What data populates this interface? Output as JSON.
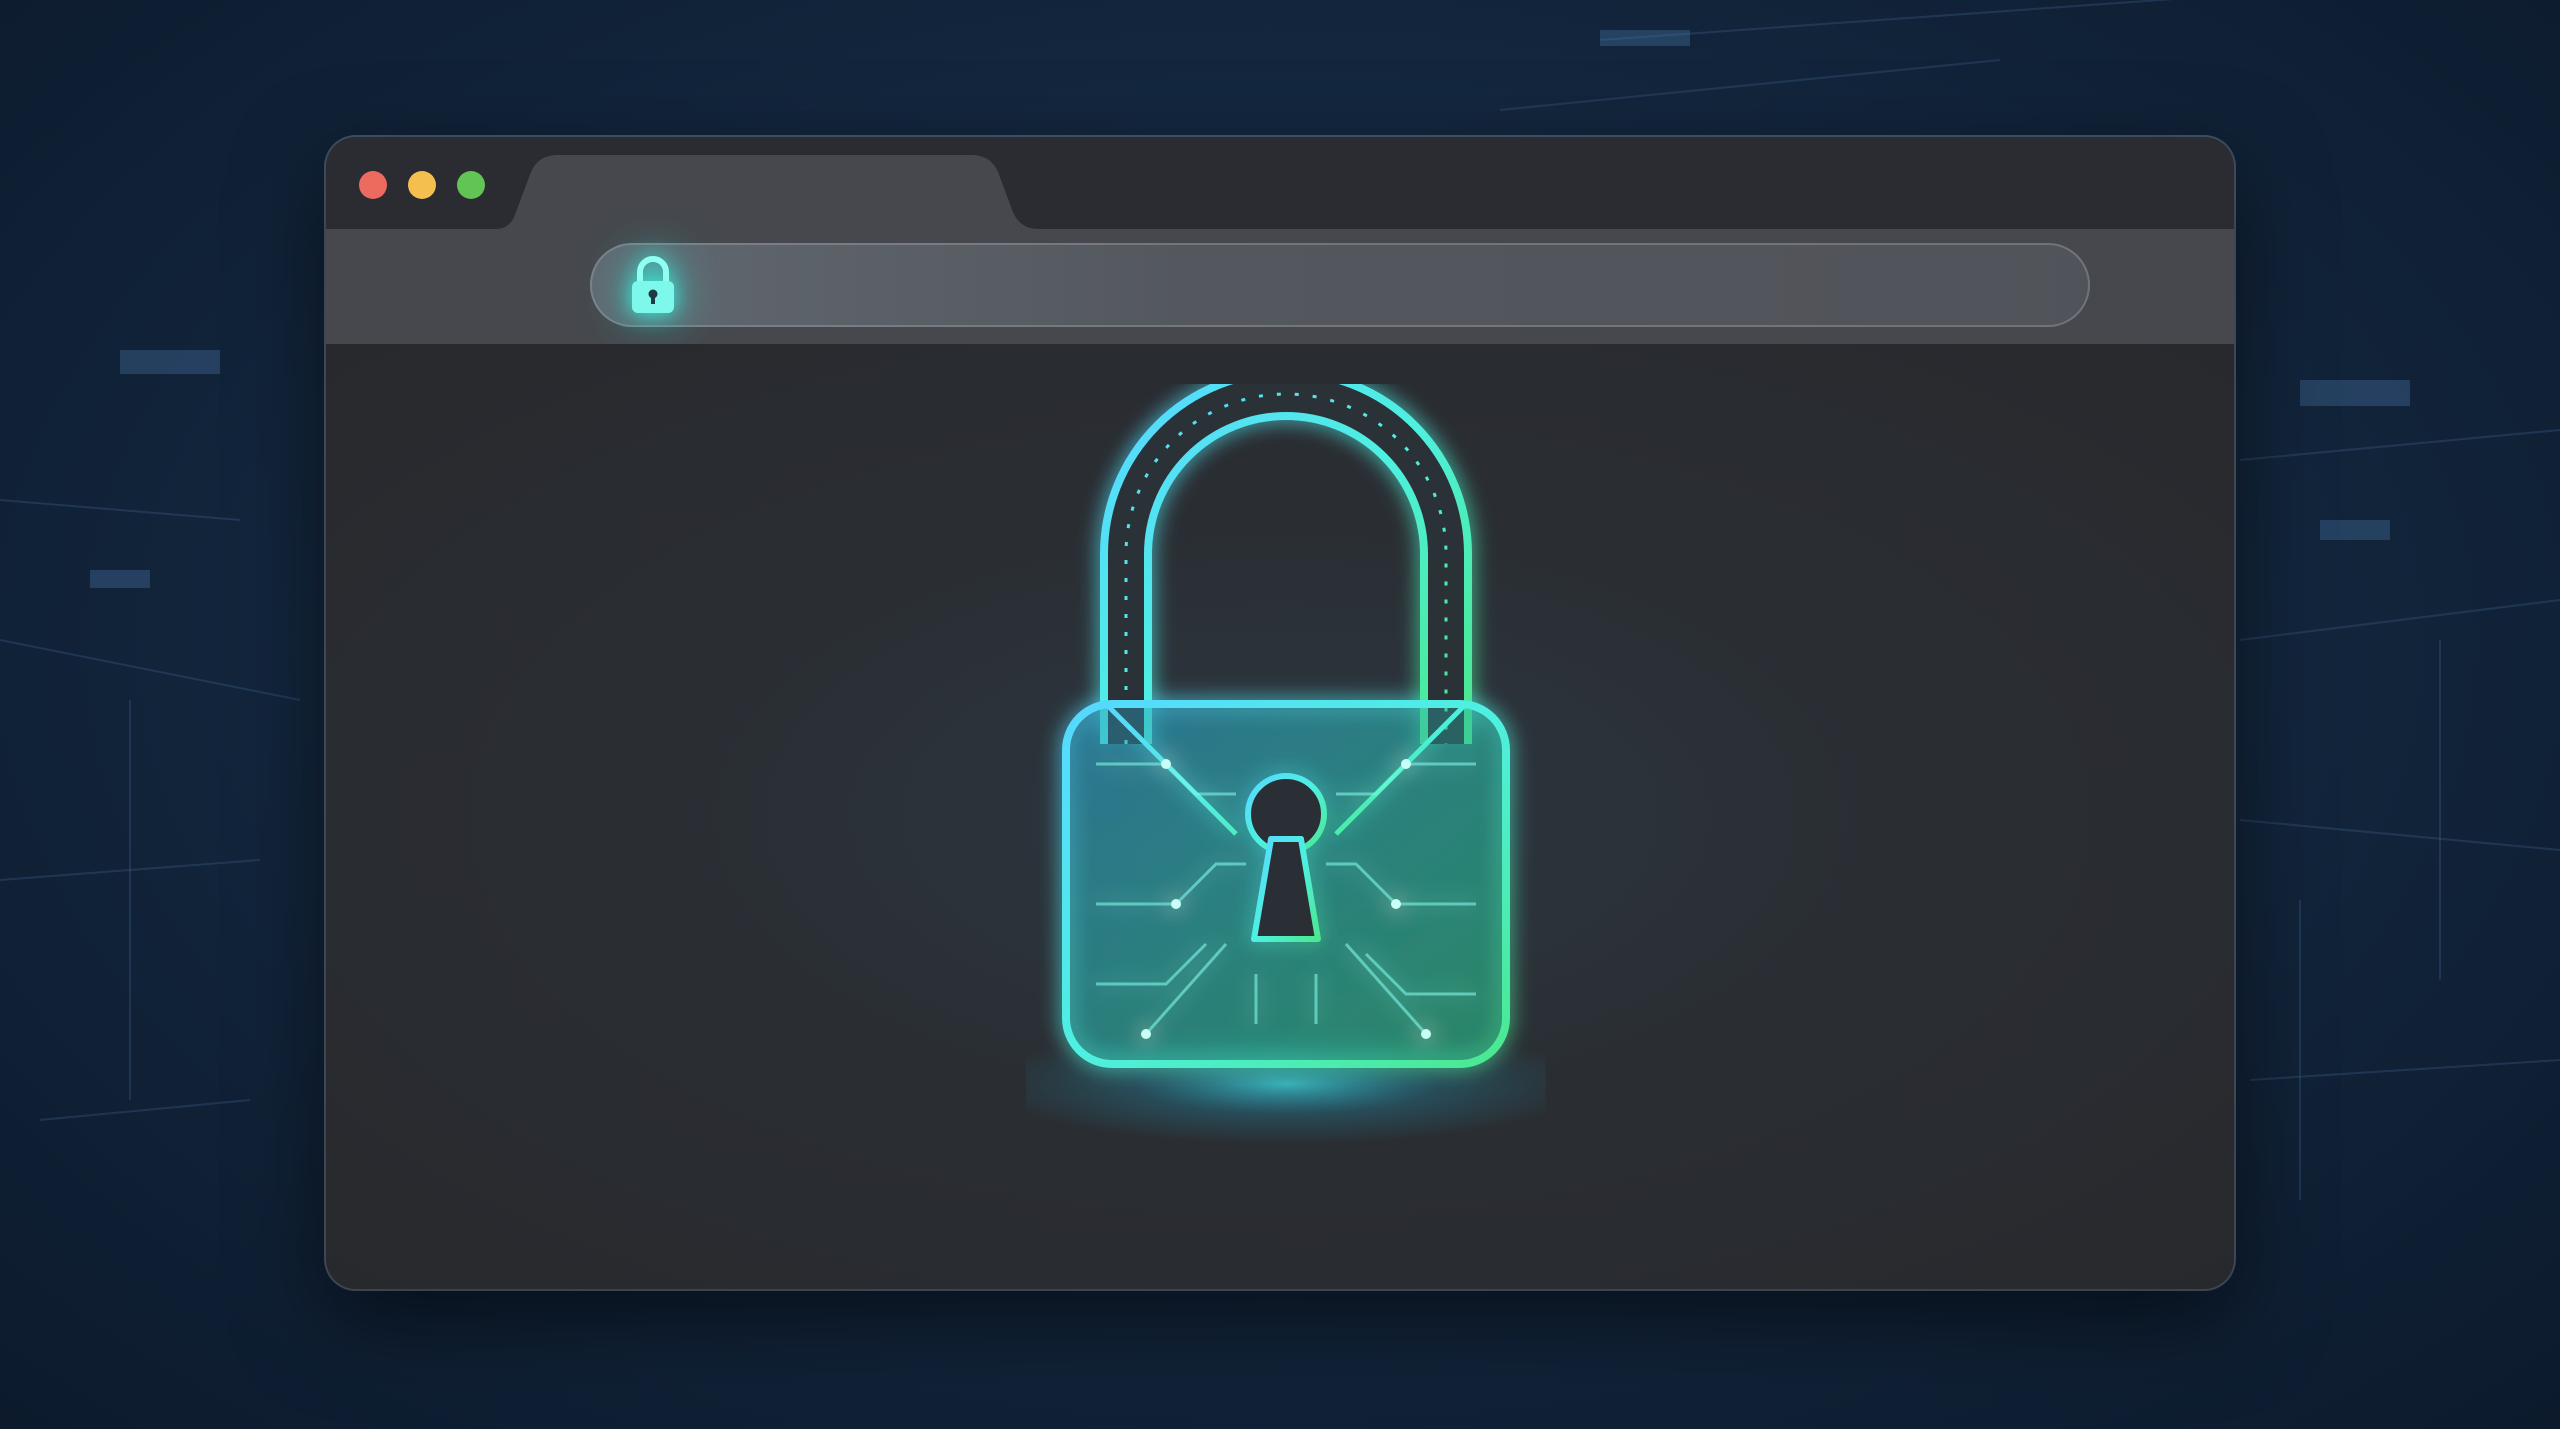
{
  "window": {
    "traffic_lights": [
      "close",
      "minimize",
      "maximize"
    ],
    "tab": {
      "title": ""
    }
  },
  "address_bar": {
    "icon": "lock-icon",
    "url": ""
  },
  "content": {
    "hero_icon": "padlock-circuit-icon"
  },
  "colors": {
    "background": "#142840",
    "window": "#2b2e34",
    "toolbar": "#46484d",
    "accent_cyan": "#3ff2e0",
    "accent_green": "#45e89a",
    "close": "#ed6a5e",
    "minimize": "#f4bf4f",
    "maximize": "#61c454"
  }
}
